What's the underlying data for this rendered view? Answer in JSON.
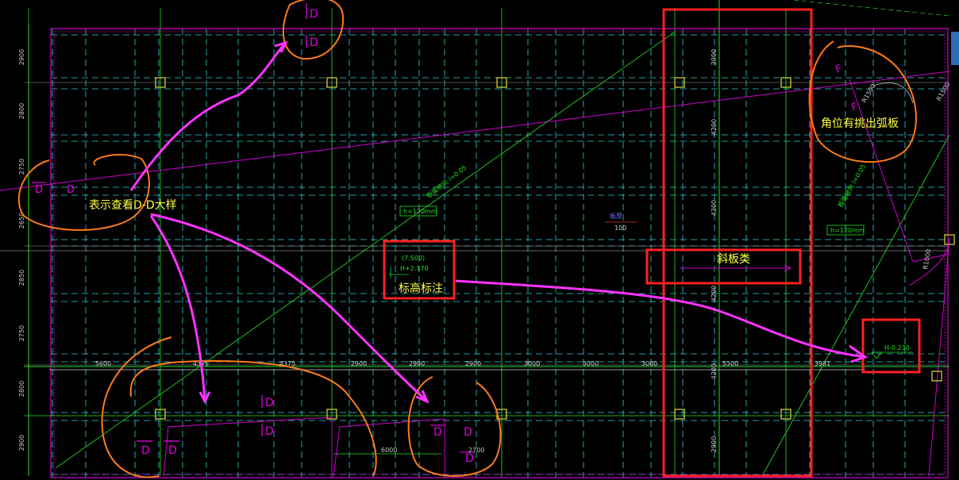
{
  "annotations": {
    "dd_detail": "表示查看D-D大样",
    "corner_arc": "角位有挑出弧板",
    "slope_slab": "斜板类",
    "elevation_note": "标高标注"
  },
  "elevation": {
    "line1": "(7.500)",
    "line2": "H+2.170"
  },
  "slab_thickness": [
    "h=120mm",
    "h=120mm"
  ],
  "h_value": "H-0.230",
  "small_label": {
    "top": "板厚",
    "bottom": "100"
  },
  "dims_bottom": [
    "5600",
    "4375",
    "4375",
    "2900",
    "2900",
    "2900",
    "3000",
    "3000",
    "3000",
    "5300",
    "3981"
  ],
  "dims_bottom2": [
    "6000",
    "2700"
  ],
  "dims_left": [
    "2900",
    "2800",
    "2750",
    "2650",
    "2850",
    "2750",
    "2800",
    "2900"
  ],
  "dims_right": [
    "2900",
    "4200",
    "4200",
    "4200",
    "4200",
    "2900"
  ],
  "section_marks": [
    "D",
    "D",
    "D",
    "D",
    "D",
    "D",
    "D",
    "D",
    "D",
    "D",
    "D"
  ],
  "corner_labels": [
    "F",
    "F",
    "R1500",
    "R1500",
    "R1000"
  ],
  "colors": {
    "red": "#ff2020",
    "orange": "#ff7a1a",
    "magenta": "#ff33ff",
    "cyan": "#40e0e0",
    "green": "#20e020",
    "yellow": "#ffff40"
  }
}
